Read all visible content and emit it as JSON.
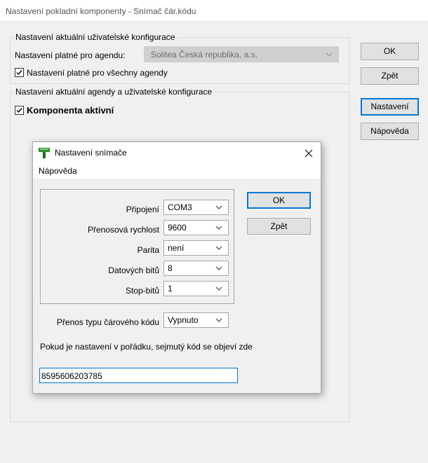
{
  "window": {
    "title": "Nastavení pokladní komponenty - Snímač čár.kódu"
  },
  "main": {
    "group1": {
      "legend": "Nastavení aktuální uživatelské konfigurace",
      "agenda_label": "Nastavení platné pro agendu:",
      "agenda_value": "Solitea Česká republika, a.s.",
      "all_agendas_label": "Nastavení platné pro všechny agendy",
      "all_agendas_checked": true
    },
    "group2": {
      "legend": "Nastavení aktuální agendy a uživatelské konfigurace",
      "component_active_label": "Komponenta aktivní",
      "component_active_checked": true
    },
    "buttons": {
      "ok": "OK",
      "back": "Zpět",
      "settings": "Nastavení",
      "help": "Nápověda"
    }
  },
  "dialog": {
    "title": "Nastavení snímače",
    "menu": [
      "Nápověda"
    ],
    "fields": [
      {
        "label": "Připojení",
        "value": "COM3"
      },
      {
        "label": "Přenosová rychlost",
        "value": "9600"
      },
      {
        "label": "Parita",
        "value": "není"
      },
      {
        "label": "Datových bitů",
        "value": "8"
      },
      {
        "label": "Stop-bitů",
        "value": "1"
      }
    ],
    "barcode_type_label": "Přenos typu čárového kódu",
    "barcode_type_value": "Vypnuto",
    "info_text": "Pokud je nastavení v pořádku, sejmutý kód se objeví zde",
    "scanned_code": "8595606203785",
    "buttons": {
      "ok": "OK",
      "back": "Zpět"
    }
  },
  "colors": {
    "focus": "#0078d7",
    "disabled_combo": "#cfcfcf",
    "button_face": "#e1e1e1"
  }
}
